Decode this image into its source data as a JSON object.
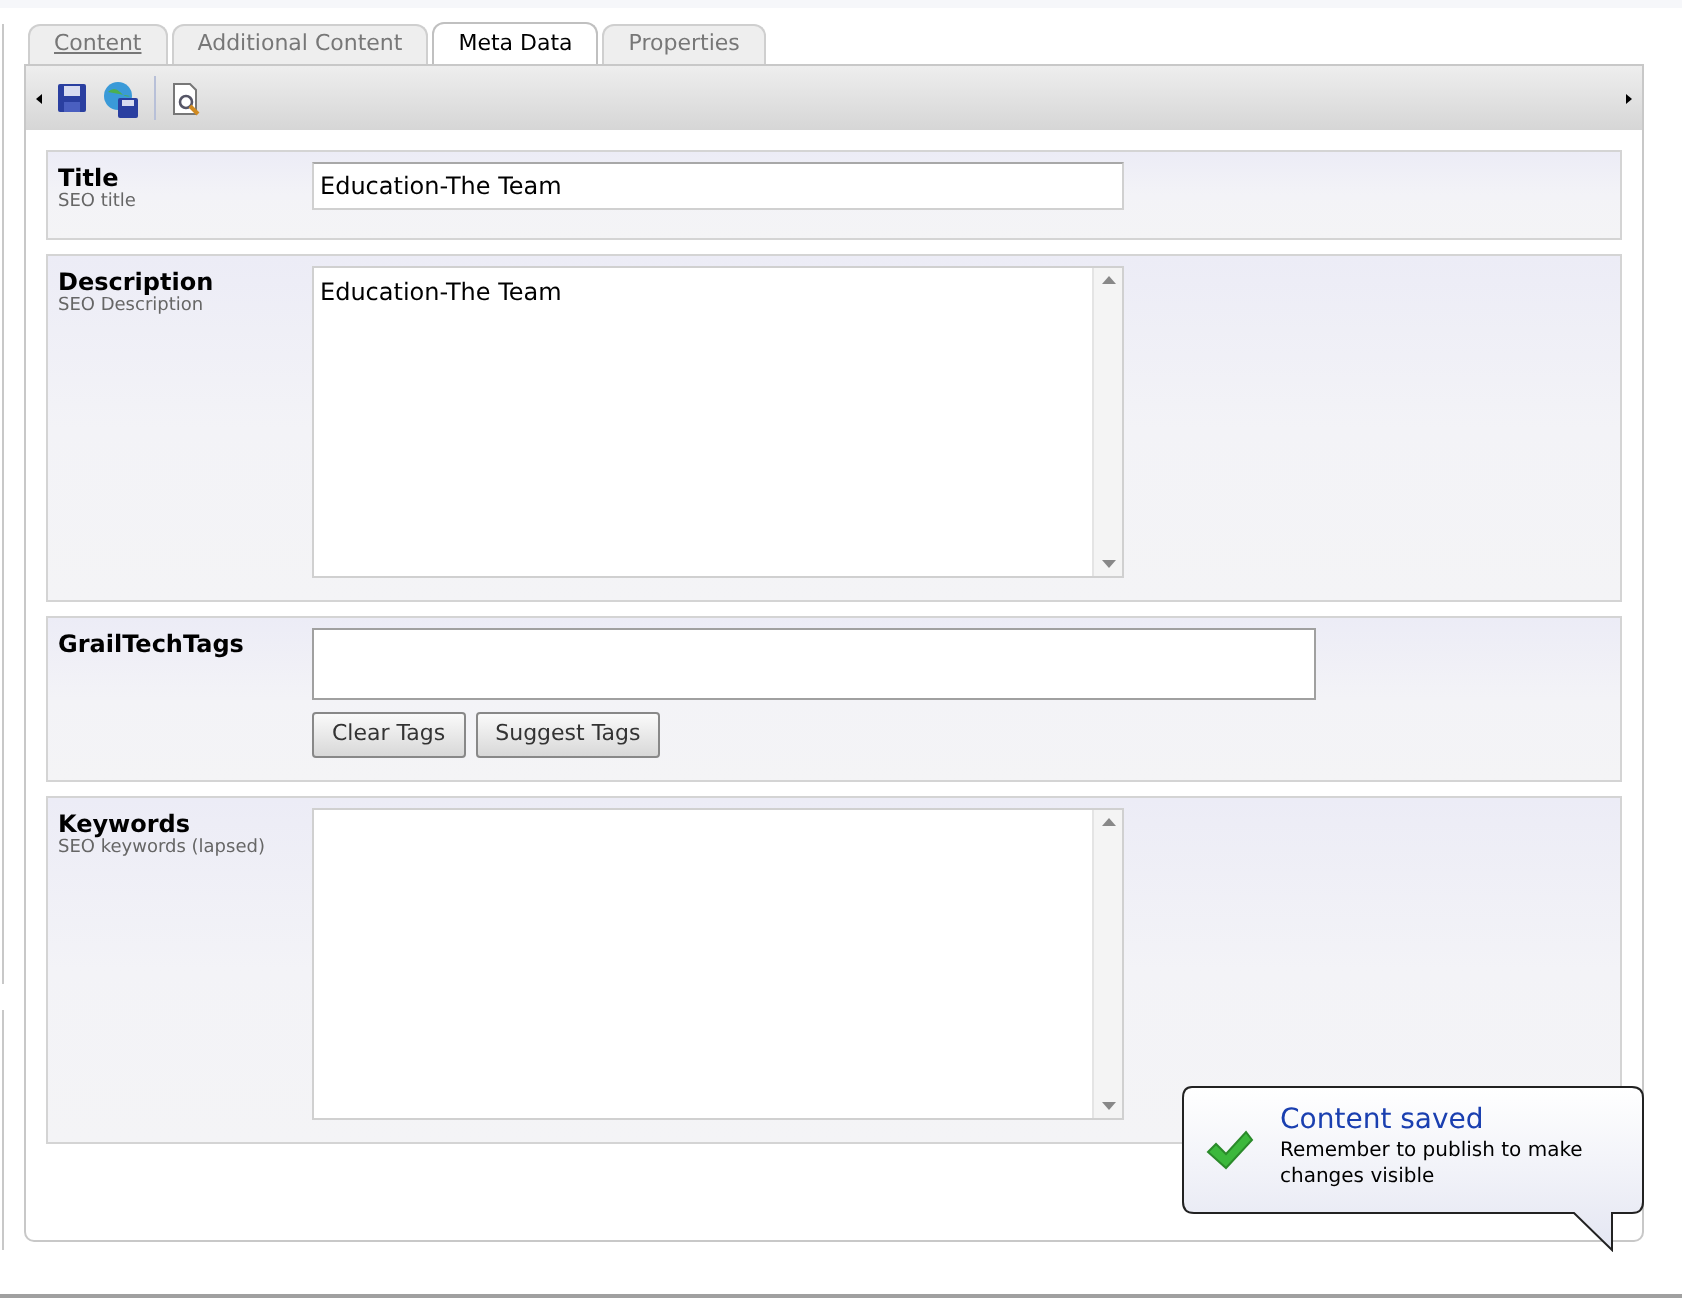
{
  "tabs": [
    {
      "label": "Content",
      "selected": false,
      "focused": true
    },
    {
      "label": "Additional Content",
      "selected": false,
      "focused": false
    },
    {
      "label": "Meta Data",
      "selected": true,
      "focused": false
    },
    {
      "label": "Properties",
      "selected": false,
      "focused": false
    }
  ],
  "fields": [
    {
      "kind": "text",
      "label": "Title",
      "hint": "SEO title",
      "value": "Education-The Team"
    },
    {
      "kind": "textarea",
      "label": "Description",
      "hint": "SEO Description",
      "value": "Education-The Team"
    },
    {
      "kind": "tags",
      "label": "GrailTechTags",
      "buttons": [
        "Clear Tags",
        "Suggest Tags"
      ]
    },
    {
      "kind": "textarea",
      "label": "Keywords",
      "hint": "SEO keywords (lapsed)"
    }
  ],
  "notification": {
    "title": "Content saved",
    "message": "Remember to publish to make changes visible"
  }
}
